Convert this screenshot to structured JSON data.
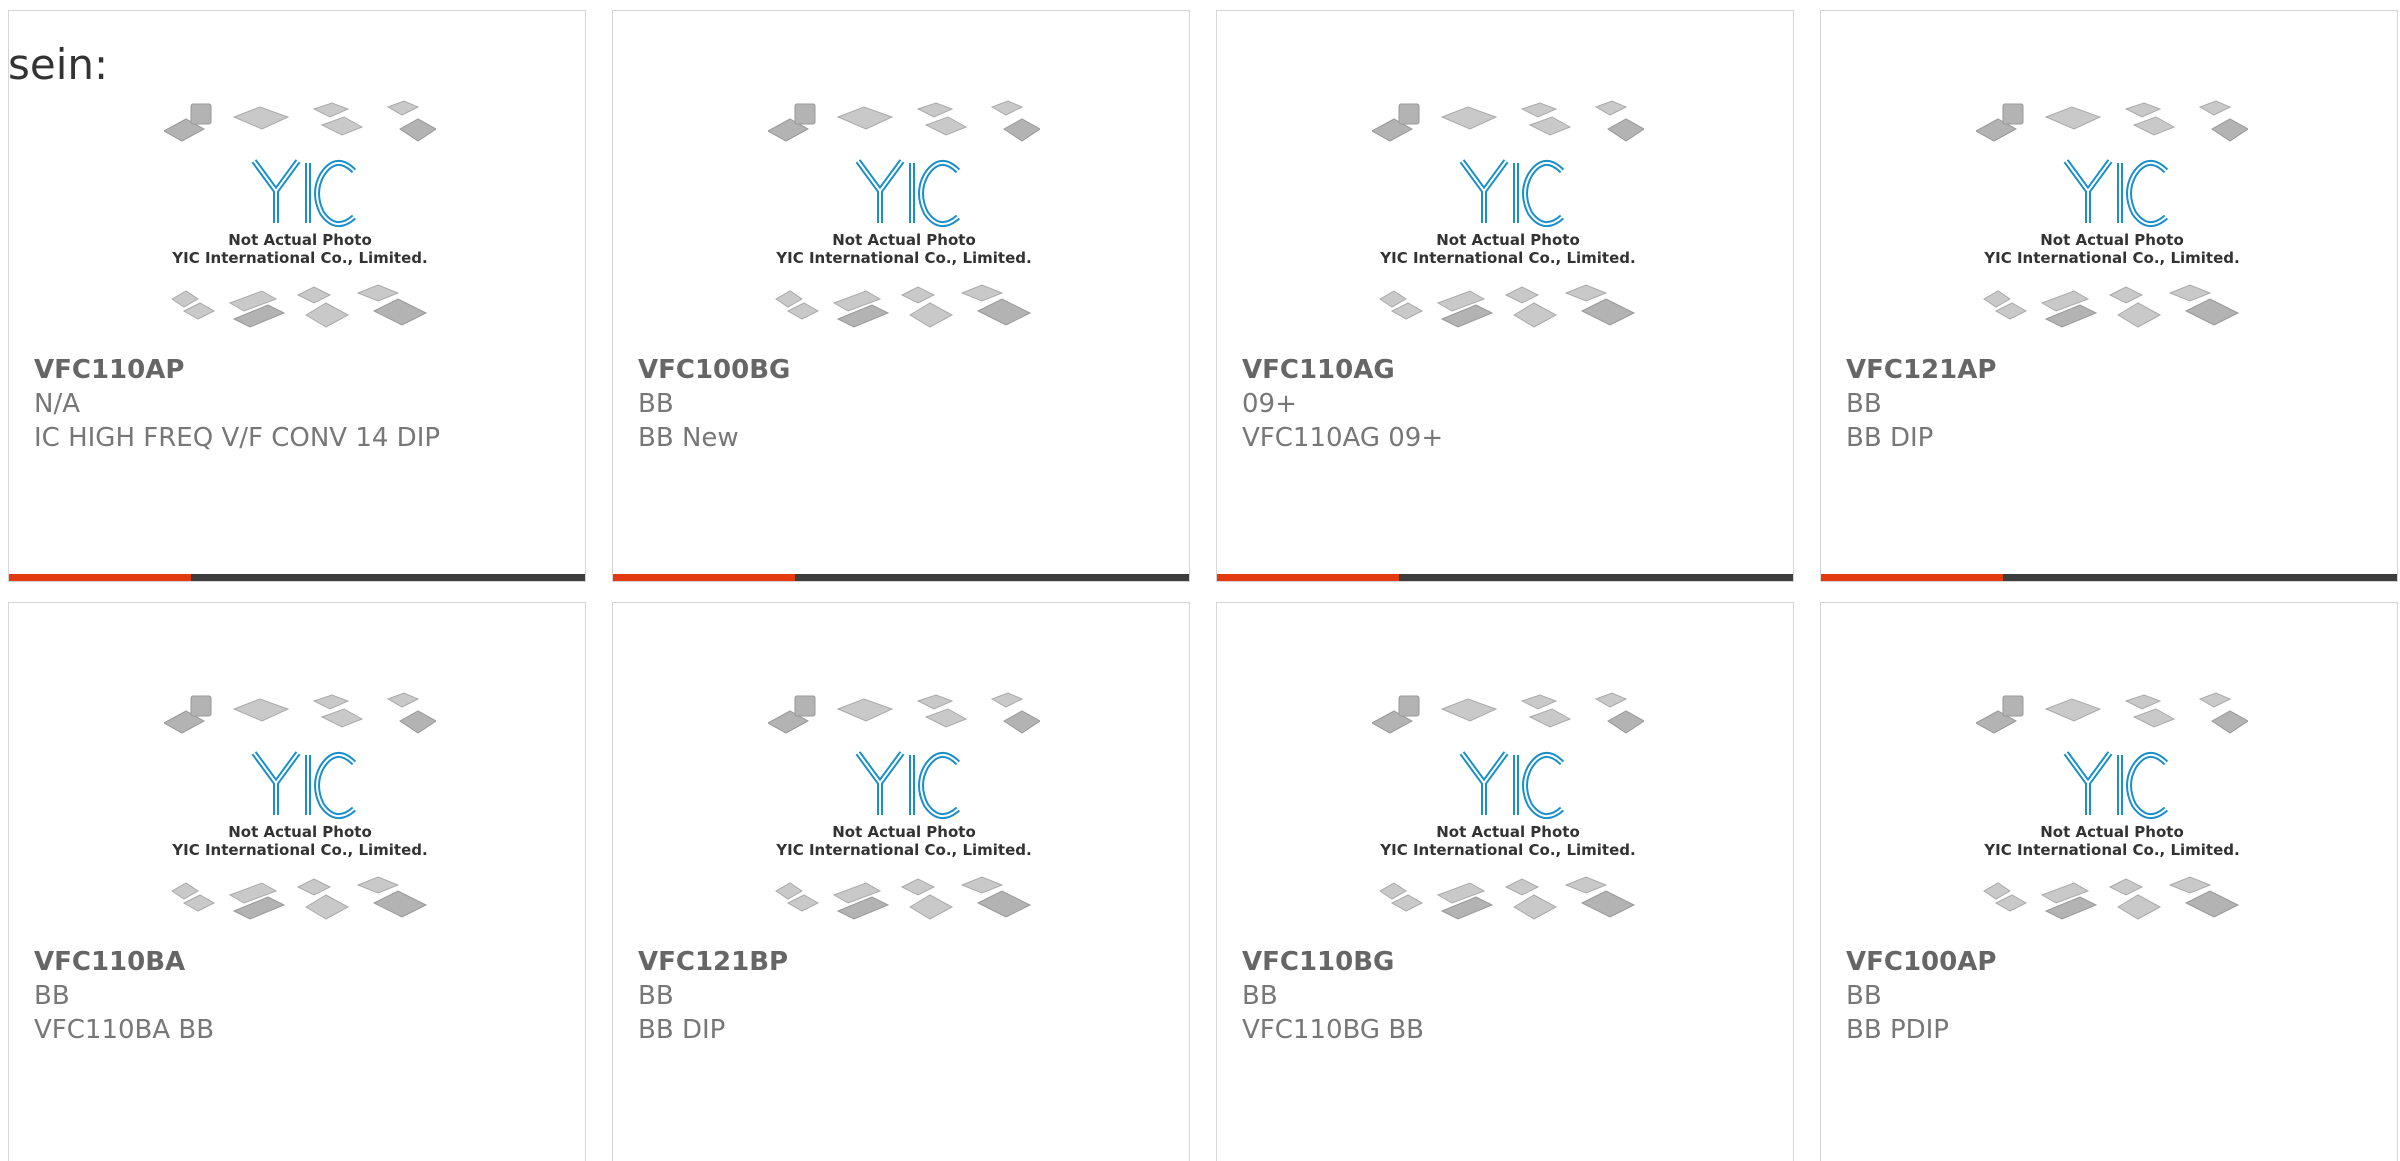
{
  "intro_text": "sein:",
  "placeholder_caption_line1": "Not Actual Photo",
  "placeholder_caption_line2": "YIC International Co., Limited.",
  "placeholder_logo_text": "YIC",
  "colors": {
    "accent": "#e33a10",
    "bar": "#3d3d3d",
    "logo": "#1a8fc9"
  },
  "products": [
    {
      "part": "VFC110AP",
      "brand": "N/A",
      "desc": "IC HIGH FREQ V/F CONV 14 DIP"
    },
    {
      "part": "VFC100BG",
      "brand": "BB",
      "desc": "BB New"
    },
    {
      "part": "VFC110AG",
      "brand": "09+",
      "desc": "VFC110AG 09+"
    },
    {
      "part": "VFC121AP",
      "brand": "BB",
      "desc": "BB DIP"
    },
    {
      "part": "VFC110BA",
      "brand": "BB",
      "desc": "VFC110BA BB"
    },
    {
      "part": "VFC121BP",
      "brand": "BB",
      "desc": "BB DIP"
    },
    {
      "part": "VFC110BG",
      "brand": "BB",
      "desc": "VFC110BG BB"
    },
    {
      "part": "VFC100AP",
      "brand": "BB",
      "desc": "BB PDIP"
    }
  ]
}
